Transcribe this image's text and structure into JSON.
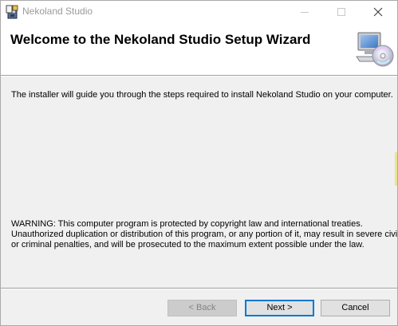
{
  "window": {
    "title": "Nekoland Studio"
  },
  "banner": {
    "title": "Welcome to the Nekoland Studio Setup Wizard"
  },
  "body": {
    "intro": "The installer will guide you through the steps required to install Nekoland Studio on your computer.",
    "warning_lines": [
      "WARNING: This computer program is protected by copyright law and international treaties.",
      "Unauthorized duplication or distribution of this program, or any portion of it, may result in severe civil",
      "or criminal penalties, and will be prosecuted to the maximum extent possible under the law."
    ]
  },
  "buttons": {
    "back": "< Back",
    "next": "Next >",
    "cancel": "Cancel"
  },
  "colors": {
    "focus_border": "#0078d7",
    "dialog_bg": "#f0f0f0",
    "disabled_text": "#838383"
  }
}
